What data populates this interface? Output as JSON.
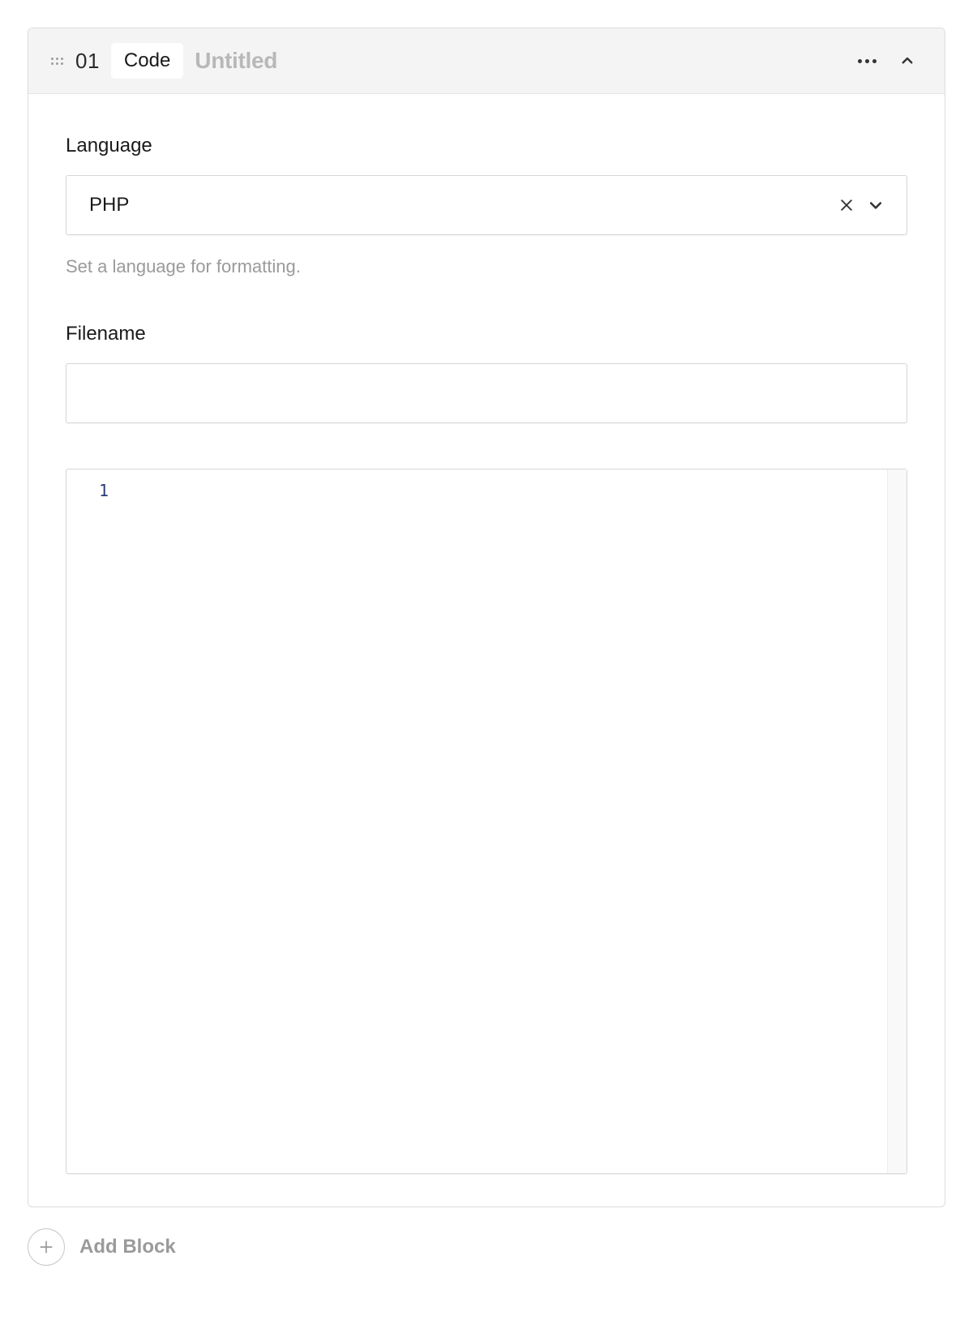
{
  "block": {
    "header": {
      "index": "01",
      "type_label": "Code",
      "title": "Untitled"
    },
    "language": {
      "label": "Language",
      "value": "PHP",
      "help": "Set a language for formatting."
    },
    "filename": {
      "label": "Filename",
      "value": ""
    },
    "editor": {
      "line_numbers": [
        "1"
      ],
      "content": ""
    }
  },
  "add_block": {
    "label": "Add Block"
  }
}
